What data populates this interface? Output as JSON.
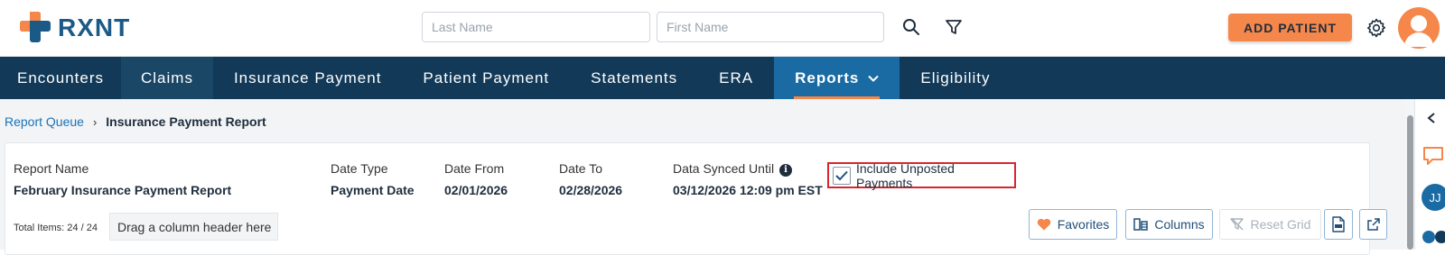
{
  "header": {
    "logo_text": "RXNT",
    "last_name_placeholder": "Last Name",
    "first_name_placeholder": "First Name",
    "add_patient_label": "ADD PATIENT"
  },
  "nav": {
    "items": [
      {
        "label": "Encounters"
      },
      {
        "label": "Claims"
      },
      {
        "label": "Insurance Payment"
      },
      {
        "label": "Patient Payment"
      },
      {
        "label": "Statements"
      },
      {
        "label": "ERA"
      },
      {
        "label": "Reports"
      },
      {
        "label": "Eligibility"
      }
    ]
  },
  "breadcrumb": {
    "parent": "Report Queue",
    "separator": "›",
    "current": "Insurance Payment Report"
  },
  "report": {
    "name_label": "Report Name",
    "name_value": "February Insurance Payment Report",
    "date_type_label": "Date Type",
    "date_type_value": "Payment Date",
    "date_from_label": "Date From",
    "date_from_value": "02/01/2026",
    "date_to_label": "Date To",
    "date_to_value": "02/28/2026",
    "synced_label": "Data Synced Until",
    "synced_value": "03/12/2026 12:09 pm EST",
    "include_unposted_label": "Include Unposted Payments",
    "include_unposted_checked": true
  },
  "grid": {
    "total_items": "Total Items: 24 / 24",
    "drag_hint": "Drag a column header here",
    "favorites_label": "Favorites",
    "columns_label": "Columns",
    "reset_grid_label": "Reset Grid"
  },
  "right_rail": {
    "user_initials": "JJ"
  },
  "colors": {
    "brand_blue": "#1b5a86",
    "brand_orange": "#f5874a",
    "nav_bg": "#123a58",
    "nav_active": "#1a6ba3",
    "highlight_red": "#d6262e"
  }
}
